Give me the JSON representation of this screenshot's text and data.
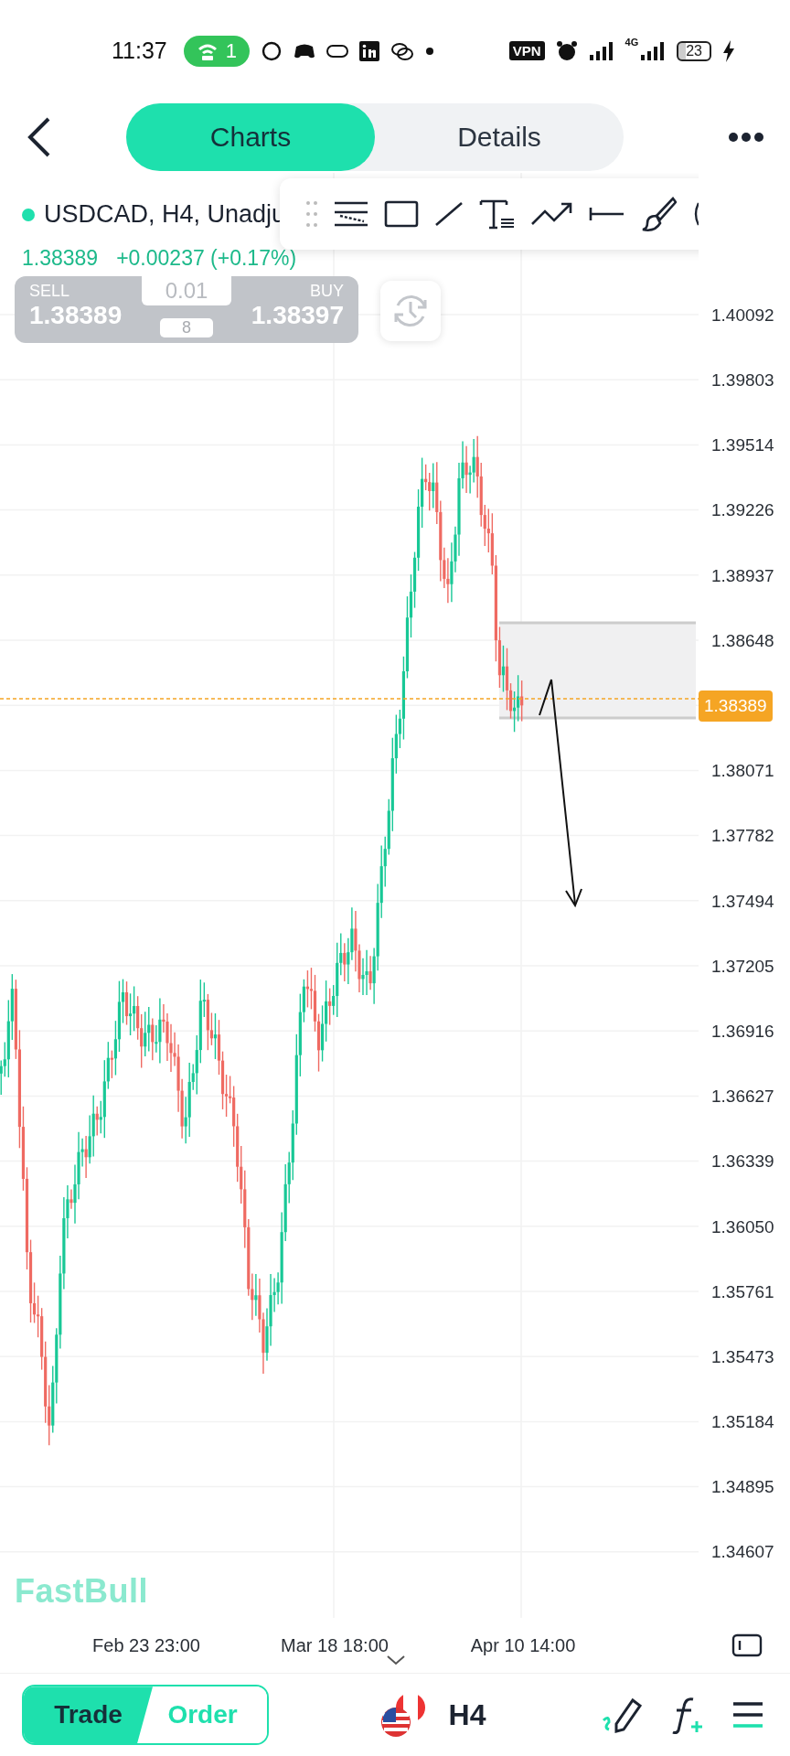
{
  "status_bar": {
    "time": "11:37",
    "hotspot_count": "1",
    "vpn": "VPN",
    "network": "4G",
    "battery": "23"
  },
  "header": {
    "tabs": [
      {
        "label": "Charts",
        "selected": true
      },
      {
        "label": "Details",
        "selected": false
      }
    ]
  },
  "symbol": {
    "title": "USDCAD, H4, Unadju",
    "price": "1.38389",
    "change": "+0.00237 (+0.17%)"
  },
  "trade_panel": {
    "sell_label": "SELL",
    "sell_price": "1.38389",
    "lot": "0.01",
    "spread": "8",
    "buy_label": "BUY",
    "buy_price": "1.38397"
  },
  "chart": {
    "watermark": "FastBull",
    "price_axis": [
      {
        "kind": "tick",
        "label": "1.40092"
      },
      {
        "kind": "tick",
        "label": "1.39803"
      },
      {
        "kind": "tick",
        "label": "1.39514"
      },
      {
        "kind": "tick",
        "label": "1.39226"
      },
      {
        "kind": "tick",
        "label": "1.38937"
      },
      {
        "kind": "tick",
        "label": "1.38648"
      },
      {
        "kind": "current",
        "label": "1.38389"
      },
      {
        "kind": "tick",
        "label": "1.38071"
      },
      {
        "kind": "tick",
        "label": "1.37782"
      },
      {
        "kind": "tick",
        "label": "1.37494"
      },
      {
        "kind": "tick",
        "label": "1.37205"
      },
      {
        "kind": "tick",
        "label": "1.36916"
      },
      {
        "kind": "tick",
        "label": "1.36627"
      },
      {
        "kind": "tick",
        "label": "1.36339"
      },
      {
        "kind": "tick",
        "label": "1.36050"
      },
      {
        "kind": "tick",
        "label": "1.35761"
      },
      {
        "kind": "tick",
        "label": "1.35473"
      },
      {
        "kind": "tick",
        "label": "1.35184"
      },
      {
        "kind": "tick",
        "label": "1.34895"
      },
      {
        "kind": "tick",
        "label": "1.34607"
      }
    ],
    "time_axis": [
      "Feb 23 23:00",
      "Mar 18 18:00",
      "Apr 10 14:00"
    ]
  },
  "bottom_bar": {
    "modes": [
      {
        "label": "Trade",
        "selected": true
      },
      {
        "label": "Order",
        "selected": false
      }
    ],
    "timeframe": "H4"
  }
}
